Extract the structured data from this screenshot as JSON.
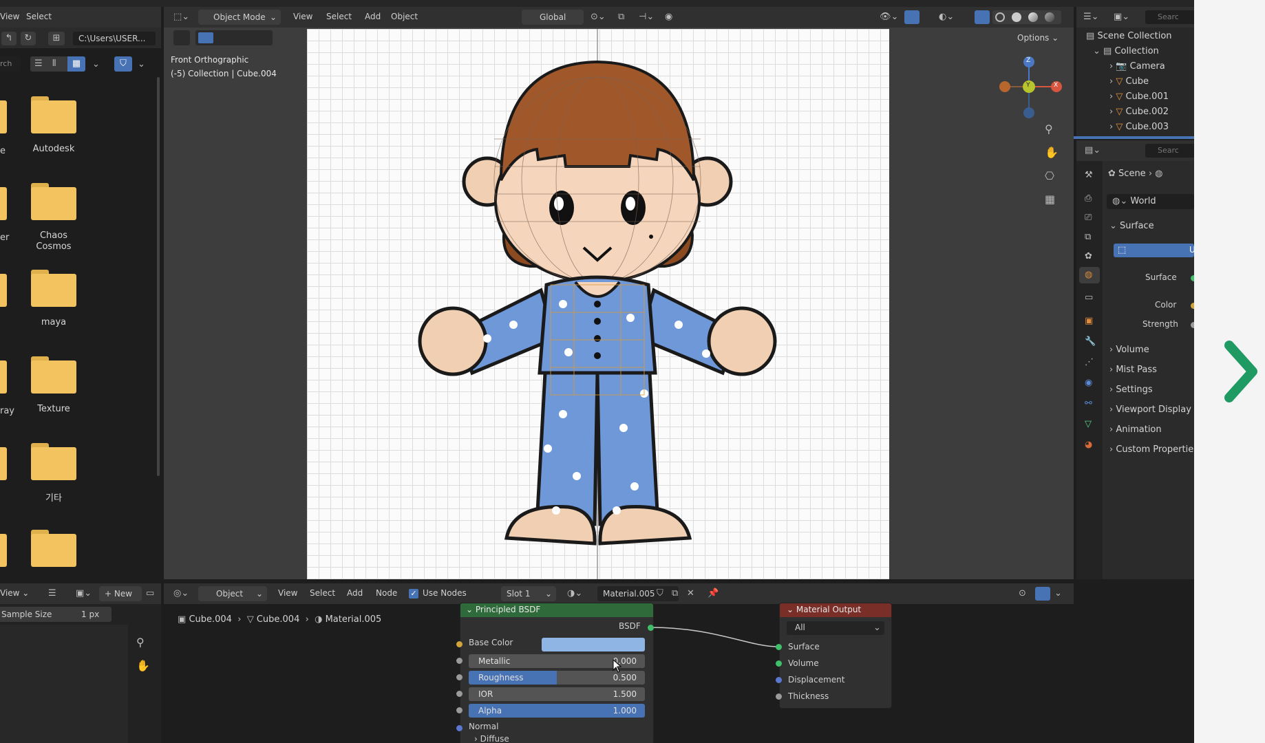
{
  "topbar": {
    "view_menu": "View",
    "select_menu": "Select"
  },
  "file_browser": {
    "path": "C:\\Users\\USER...",
    "search_fragment": "rch",
    "folders": [
      {
        "label": "Autodesk",
        "cut_label": "e"
      },
      {
        "label": "Chaos Cosmos",
        "cut_label": "er"
      },
      {
        "label": "maya",
        "cut_label": ""
      },
      {
        "label": "Texture",
        "cut_label": "ray"
      },
      {
        "label": "기타",
        "cut_label": ""
      },
      {
        "label": "",
        "cut_label": ""
      }
    ]
  },
  "viewport": {
    "editor_mode": "Object Mode",
    "menu": [
      "View",
      "Select",
      "Add",
      "Object"
    ],
    "transform": "Global",
    "options": "Options",
    "view_name": "Front Orthographic",
    "collection_info": "(-5) Collection | Cube.004",
    "gizmo_axes": [
      "Z",
      "Y",
      "X"
    ]
  },
  "outliner": {
    "search_fragment": "Searc",
    "scene_collection": "Scene Collection",
    "collection": "Collection",
    "items": [
      "Camera",
      "Cube",
      "Cube.001",
      "Cube.002",
      "Cube.003"
    ]
  },
  "properties": {
    "search_fragment": "Searc",
    "scene": "Scene",
    "world": "World",
    "surface_panel": "Surface",
    "surface_slot_fragment": "U",
    "surface_label": "Surface",
    "color_label": "Color",
    "strength_label": "Strength",
    "panels": [
      "Volume",
      "Mist Pass",
      "Settings",
      "Viewport Display",
      "Animation",
      "Custom Propertie"
    ]
  },
  "image_editor": {
    "view_menu": "View",
    "new_button": "New",
    "sample_size_label": "Sample Size",
    "sample_size_value": "1 px"
  },
  "node_editor": {
    "editor_type": "Object",
    "menu": [
      "View",
      "Select",
      "Add",
      "Node"
    ],
    "use_nodes": "Use Nodes",
    "slot": "Slot 1",
    "material": "Material.005",
    "breadcrumb": [
      "Cube.004",
      "Cube.004",
      "Material.005"
    ],
    "bsdf_node": {
      "title": "Principled BSDF",
      "output": "BSDF",
      "base_color": "Base Color",
      "metallic": {
        "label": "Metallic",
        "value": "0.000",
        "fill": 0.0
      },
      "roughness": {
        "label": "Roughness",
        "value": "0.500",
        "fill": 0.5
      },
      "ior": {
        "label": "IOR",
        "value": "1.500",
        "fill": 0.0
      },
      "alpha": {
        "label": "Alpha",
        "value": "1.000",
        "fill": 1.0
      },
      "normal": "Normal",
      "diffuse": "Diffuse"
    },
    "output_node": {
      "title": "Material Output",
      "target": "All",
      "inputs": [
        "Surface",
        "Volume",
        "Displacement",
        "Thickness"
      ]
    }
  },
  "colors": {
    "accent_blue": "#4772b3",
    "bsdf_header": "#2f6b3a",
    "output_header": "#7a2e28",
    "next_arrow": "#1f9a62",
    "base_color_swatch": "#8fb5e4"
  }
}
